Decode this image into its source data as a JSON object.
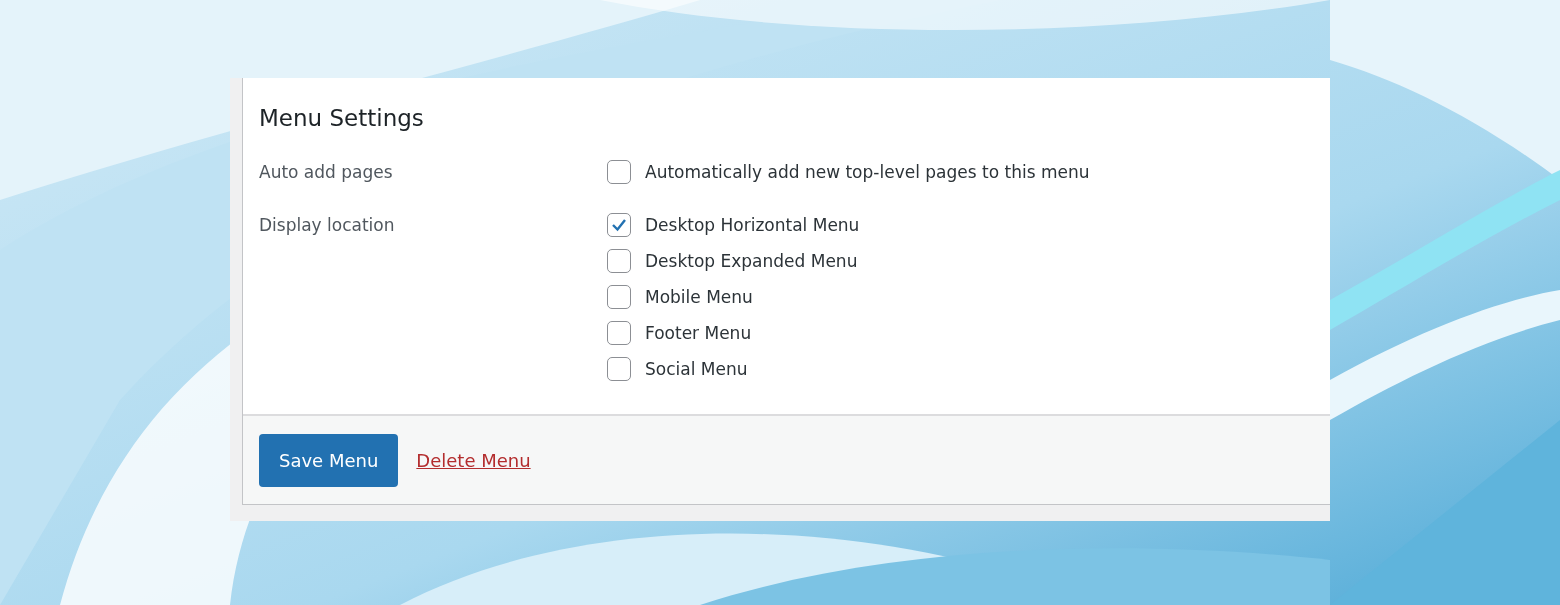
{
  "title": "Menu Settings",
  "settings": [
    {
      "label": "Auto add pages",
      "options": [
        {
          "label": "Automatically add new top-level pages to this menu",
          "checked": false
        }
      ]
    },
    {
      "label": "Display location",
      "options": [
        {
          "label": "Desktop Horizontal Menu",
          "checked": true
        },
        {
          "label": "Desktop Expanded Menu",
          "checked": false
        },
        {
          "label": "Mobile Menu",
          "checked": false
        },
        {
          "label": "Footer Menu",
          "checked": false
        },
        {
          "label": "Social Menu",
          "checked": false
        }
      ]
    }
  ],
  "actions": {
    "save": "Save Menu",
    "delete": "Delete Menu"
  }
}
